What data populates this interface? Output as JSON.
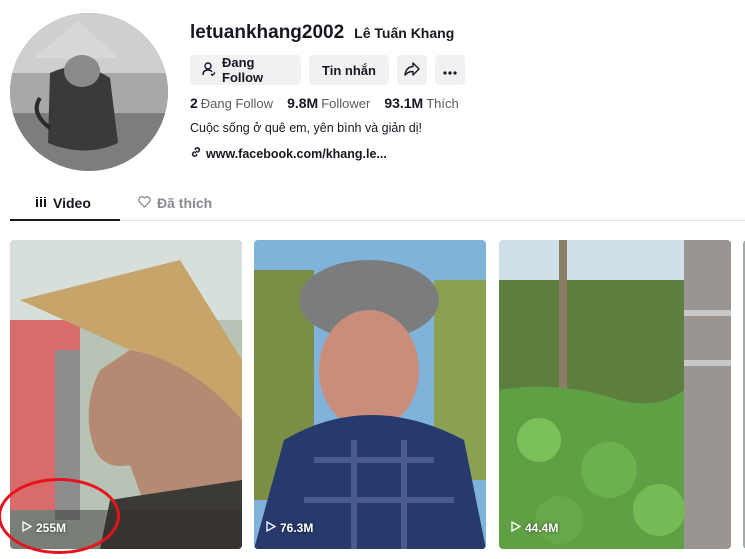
{
  "profile": {
    "username": "letuankhang2002",
    "nickname": "Lê Tuấn Khang",
    "bio": "Cuộc sống ở quê em, yên bình và giản dị!",
    "link": "www.facebook.com/khang.le..."
  },
  "actions": {
    "following_label": "Đang Follow",
    "message_label": "Tin nhắn"
  },
  "stats": {
    "following_count": "2",
    "following_label": "Đang Follow",
    "followers_count": "9.8M",
    "followers_label": "Follower",
    "likes_count": "93.1M",
    "likes_label": "Thích"
  },
  "tabs": [
    {
      "label": "Video",
      "active": true
    },
    {
      "label": "Đã thích",
      "active": false
    }
  ],
  "videos": [
    {
      "views": "255M"
    },
    {
      "views": "76.3M"
    },
    {
      "views": "44.4M"
    }
  ],
  "colors": {
    "annotation_circle": "#e8121c",
    "button_bg": "#f1f1f2"
  }
}
